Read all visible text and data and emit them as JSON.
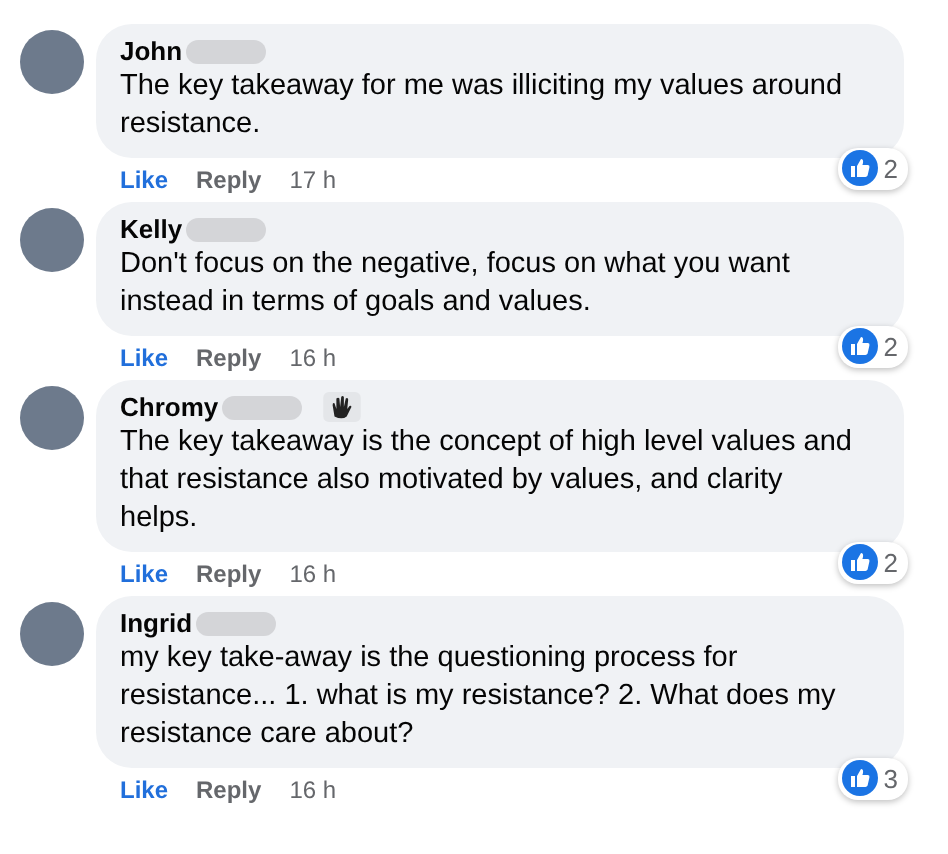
{
  "comments": [
    {
      "author": "John",
      "name_redacted": true,
      "badge": false,
      "text": "The key takeaway for me was illiciting my values around resistance.",
      "like": "Like",
      "liked": true,
      "reply": "Reply",
      "time": "17 h",
      "reactions": "2"
    },
    {
      "author": "Kelly",
      "name_redacted": true,
      "badge": false,
      "text": "Don't focus on the negative, focus on what you want instead in terms of goals and values.",
      "like": "Like",
      "liked": true,
      "reply": "Reply",
      "time": "16 h",
      "reactions": "2"
    },
    {
      "author": "Chromy",
      "name_redacted": true,
      "badge": true,
      "text": "The key takeaway is the concept of high level values and that resistance also motivated by values, and clarity helps.",
      "like": "Like",
      "liked": true,
      "reply": "Reply",
      "time": "16 h",
      "reactions": "2"
    },
    {
      "author": "Ingrid",
      "name_redacted": true,
      "badge": false,
      "text": "my key take-away is the questioning process for resistance... 1. what is my resistance? 2. What does my resistance care about?",
      "like": "Like",
      "liked": true,
      "reply": "Reply",
      "time": "16 h",
      "reactions": "3"
    }
  ]
}
